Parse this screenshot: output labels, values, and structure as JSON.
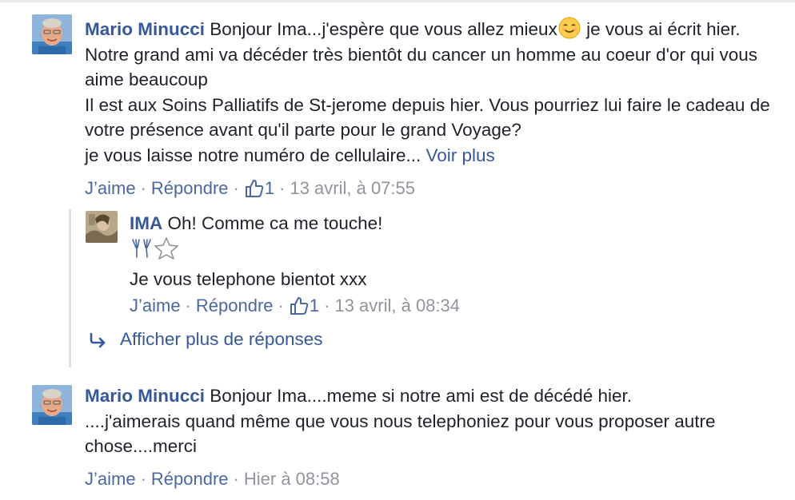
{
  "comments": [
    {
      "author": "Mario Minucci",
      "text_line1": "Bonjour Ima...j'espère que vous allez mieux",
      "text_line1b": " je vous ai écrit",
      "text_rest": "hier. Notre grand ami va décéder très bientôt du cancer un homme au coeur d'or qui vous aime beaucoup",
      "text_line3": "Il est aux Soins Palliatifs de St-jerome depuis hier. Vous pourriez lui faire le cadeau de votre présence avant qu'il parte pour le grand Voyage?",
      "text_line4": "je vous laisse notre numéro de cellulaire...",
      "see_more": "Voir plus",
      "like_label": "J’aime",
      "reply_label": "Répondre",
      "like_count": "1",
      "timestamp": "13 avril, à 07:55",
      "emoji": "smiling-face-emoji",
      "avatar_icon": "mario-avatar"
    },
    {
      "author": "Mario Minucci",
      "text_line1": "Bonjour Ima....meme si notre ami est de décédé hier.",
      "text_line2": "....j'aimerais quand même que vous nous telephoniez pour vous proposer autre chose....merci",
      "like_label": "J’aime",
      "reply_label": "Répondre",
      "timestamp": "Hier à 08:58",
      "avatar_icon": "mario-avatar"
    }
  ],
  "reply": {
    "author": "IMA",
    "text_line1": "Oh! Comme ca me touche!",
    "emoji_line": [
      "hands-doodle-icon",
      "star-outline-icon"
    ],
    "text_line2": "Je vous telephone bientot xxx",
    "like_label": "J’aime",
    "reply_label": "Répondre",
    "like_count": "1",
    "timestamp": "13 avril, à 08:34",
    "avatar_icon": "ima-avatar"
  },
  "more_replies_label": "Afficher plus de réponses",
  "separator": "·",
  "colors": {
    "link": "#365899",
    "meta": "#90949c",
    "border": "#dddfe2"
  }
}
